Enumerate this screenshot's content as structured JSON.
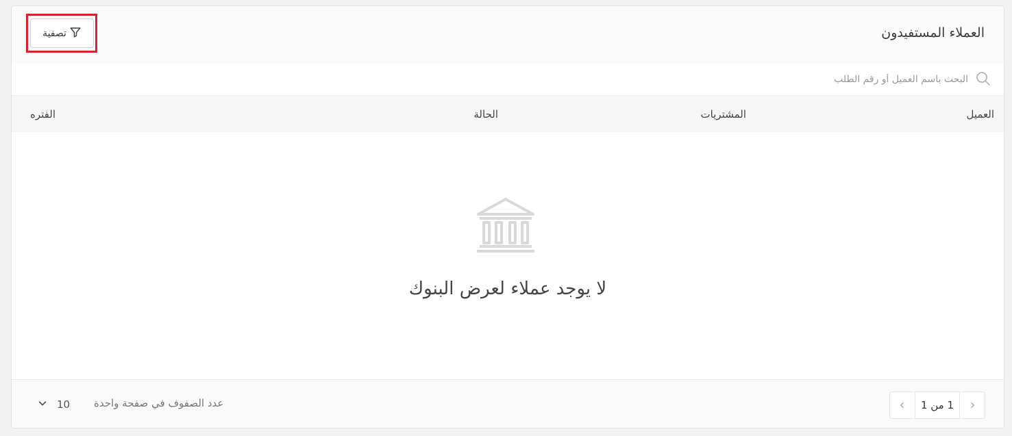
{
  "header": {
    "title": "العملاء المستفيدون",
    "filter_label": "تصفية"
  },
  "search": {
    "placeholder": "البحث باسم العميل أو رقم الطلب"
  },
  "table": {
    "columns": [
      "العميل",
      "المشتريات",
      "الحالة",
      "الفتره"
    ],
    "empty_message": "لا يوجد عملاء لعرض البنوك"
  },
  "footer": {
    "page_info": "1 من 1",
    "rows_per_page_label": "عدد الصفوف في صفحة واحدة",
    "rows_per_page_value": "10"
  },
  "colors": {
    "highlight": "#d6232f",
    "empty_icon": "#d9d9d9"
  },
  "icons": {
    "filter": "filter-icon",
    "search": "search-icon",
    "empty": "bank-icon",
    "prev": "chevron-right-icon",
    "next": "chevron-left-icon",
    "dropdown": "chevron-down-icon"
  }
}
